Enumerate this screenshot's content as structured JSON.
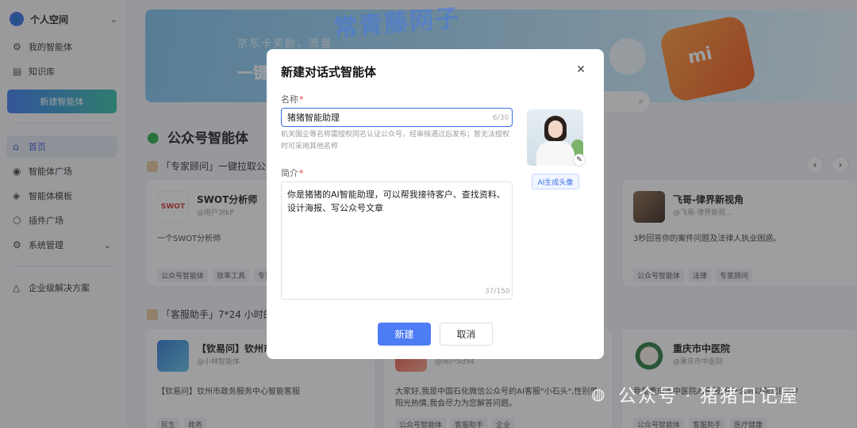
{
  "sidebar": {
    "space_label": "个人空间",
    "space_avatar_glyph": "👤",
    "items_top": [
      {
        "icon": "robot-icon",
        "glyph": "⚙",
        "label": "我的智能体"
      },
      {
        "icon": "document-icon",
        "glyph": "▤",
        "label": "知识库"
      }
    ],
    "new_agent_button": "新建智能体",
    "items_main": [
      {
        "icon": "home-icon",
        "glyph": "⌂",
        "label": "首页",
        "active": true
      },
      {
        "icon": "eye-icon",
        "glyph": "◉",
        "label": "智能体广场"
      },
      {
        "icon": "template-icon",
        "glyph": "◈",
        "label": "智能体模板"
      },
      {
        "icon": "plugin-icon",
        "glyph": "⬡",
        "label": "插件广场"
      },
      {
        "icon": "gear-icon",
        "glyph": "⚙",
        "label": "系统管理",
        "has_chevron": true
      }
    ],
    "items_bottom": [
      {
        "icon": "enterprise-icon",
        "glyph": "△",
        "label": "企业级解决方案"
      }
    ]
  },
  "banner": {
    "line1": "京东卡奖励、流量",
    "line2": "一键",
    "shop_logo_text": "mi"
  },
  "watermark_top": "常青藤网子",
  "section": {
    "title": "公众号智能体",
    "category_1": "「专家顾问」一键拉取公众",
    "category_2": "「客服助手」7*24 小时的智"
  },
  "cards": [
    {
      "name": "SWOT分析师",
      "author": "@用户3tkP",
      "logo_text": "SWOT",
      "desc": "一个SWOT分析师",
      "tags": [
        "公众号智能体",
        "效率工具",
        "专家"
      ]
    },
    {
      "name": "飞哥-律界新视角",
      "author": "@飞哥-律界新视...",
      "desc": "3秒回答你的案件问题及法律人执业困惑。",
      "tags": [
        "公众号智能体",
        "法律",
        "专家顾问"
      ]
    },
    {
      "name": "【钦易问】钦州市",
      "author": "@小林智能体",
      "desc": "【钦易问】钦州市政务服务中心智能客服",
      "tags": [
        "民生",
        "政务"
      ]
    },
    {
      "name": "",
      "author": "@用户9d94",
      "desc": "大家好,我是中国石化微信公众号的AI客服\"小石头\",性别男,阳光热情,我会尽力为您解答问题。",
      "tags": [
        "公众号智能体",
        "客服助手",
        "企业"
      ]
    },
    {
      "name": "重庆市中医院",
      "author": "@重庆市中医院",
      "desc": "我是重庆市中医院AI客服,有什么可以帮您的吗?",
      "tags": [
        "公众号智能体",
        "客服助手",
        "医疗健康"
      ]
    }
  ],
  "pager": {
    "prev": "‹",
    "next": "›"
  },
  "modal": {
    "title": "新建对话式智能体",
    "close_glyph": "✕",
    "name_label": "名称",
    "required_mark": "*",
    "name_value": "猪猪智能助理",
    "name_counter": "6/30",
    "name_hint": "机关国企等名称需授权同名认证公众号，经审核通过后发布；暂无法授权时可采用其他名称",
    "intro_label": "简介",
    "intro_value": "你是猪猪的AI智能助理，可以帮我接待客户、查找资料、设计海报、写公众号文章",
    "intro_counter": "37/150",
    "edit_glyph": "✎",
    "ai_avatar_button": "AI生成头像",
    "create_button": "新建",
    "cancel_button": "取消"
  },
  "footer_watermark": "公众号 · 猪猪日记屋",
  "colors": {
    "accent": "#4d7cf5",
    "gradient_start": "#3d7cf0",
    "gradient_end": "#34c0a8",
    "required": "#e23c3c"
  }
}
